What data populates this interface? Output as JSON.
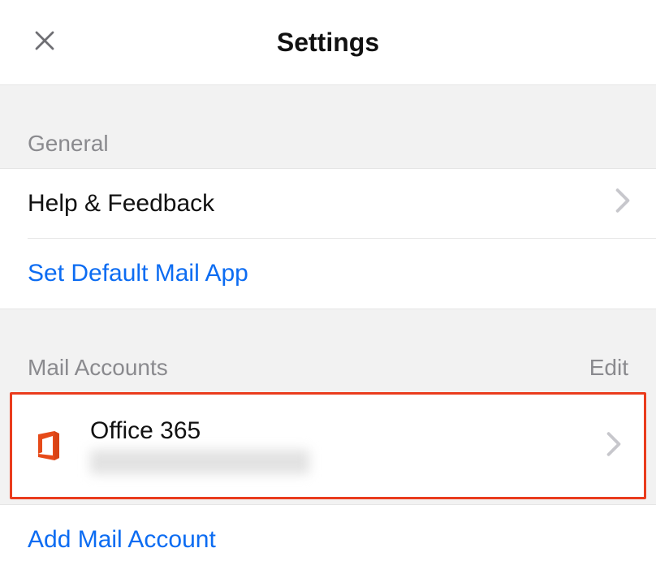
{
  "header": {
    "title": "Settings"
  },
  "sections": {
    "general": {
      "header": "General",
      "help_feedback": "Help & Feedback",
      "set_default": "Set Default Mail App"
    },
    "mail_accounts": {
      "header": "Mail Accounts",
      "edit": "Edit",
      "account": {
        "name": "Office 365",
        "email_redacted": true
      },
      "add": "Add Mail Account"
    }
  }
}
